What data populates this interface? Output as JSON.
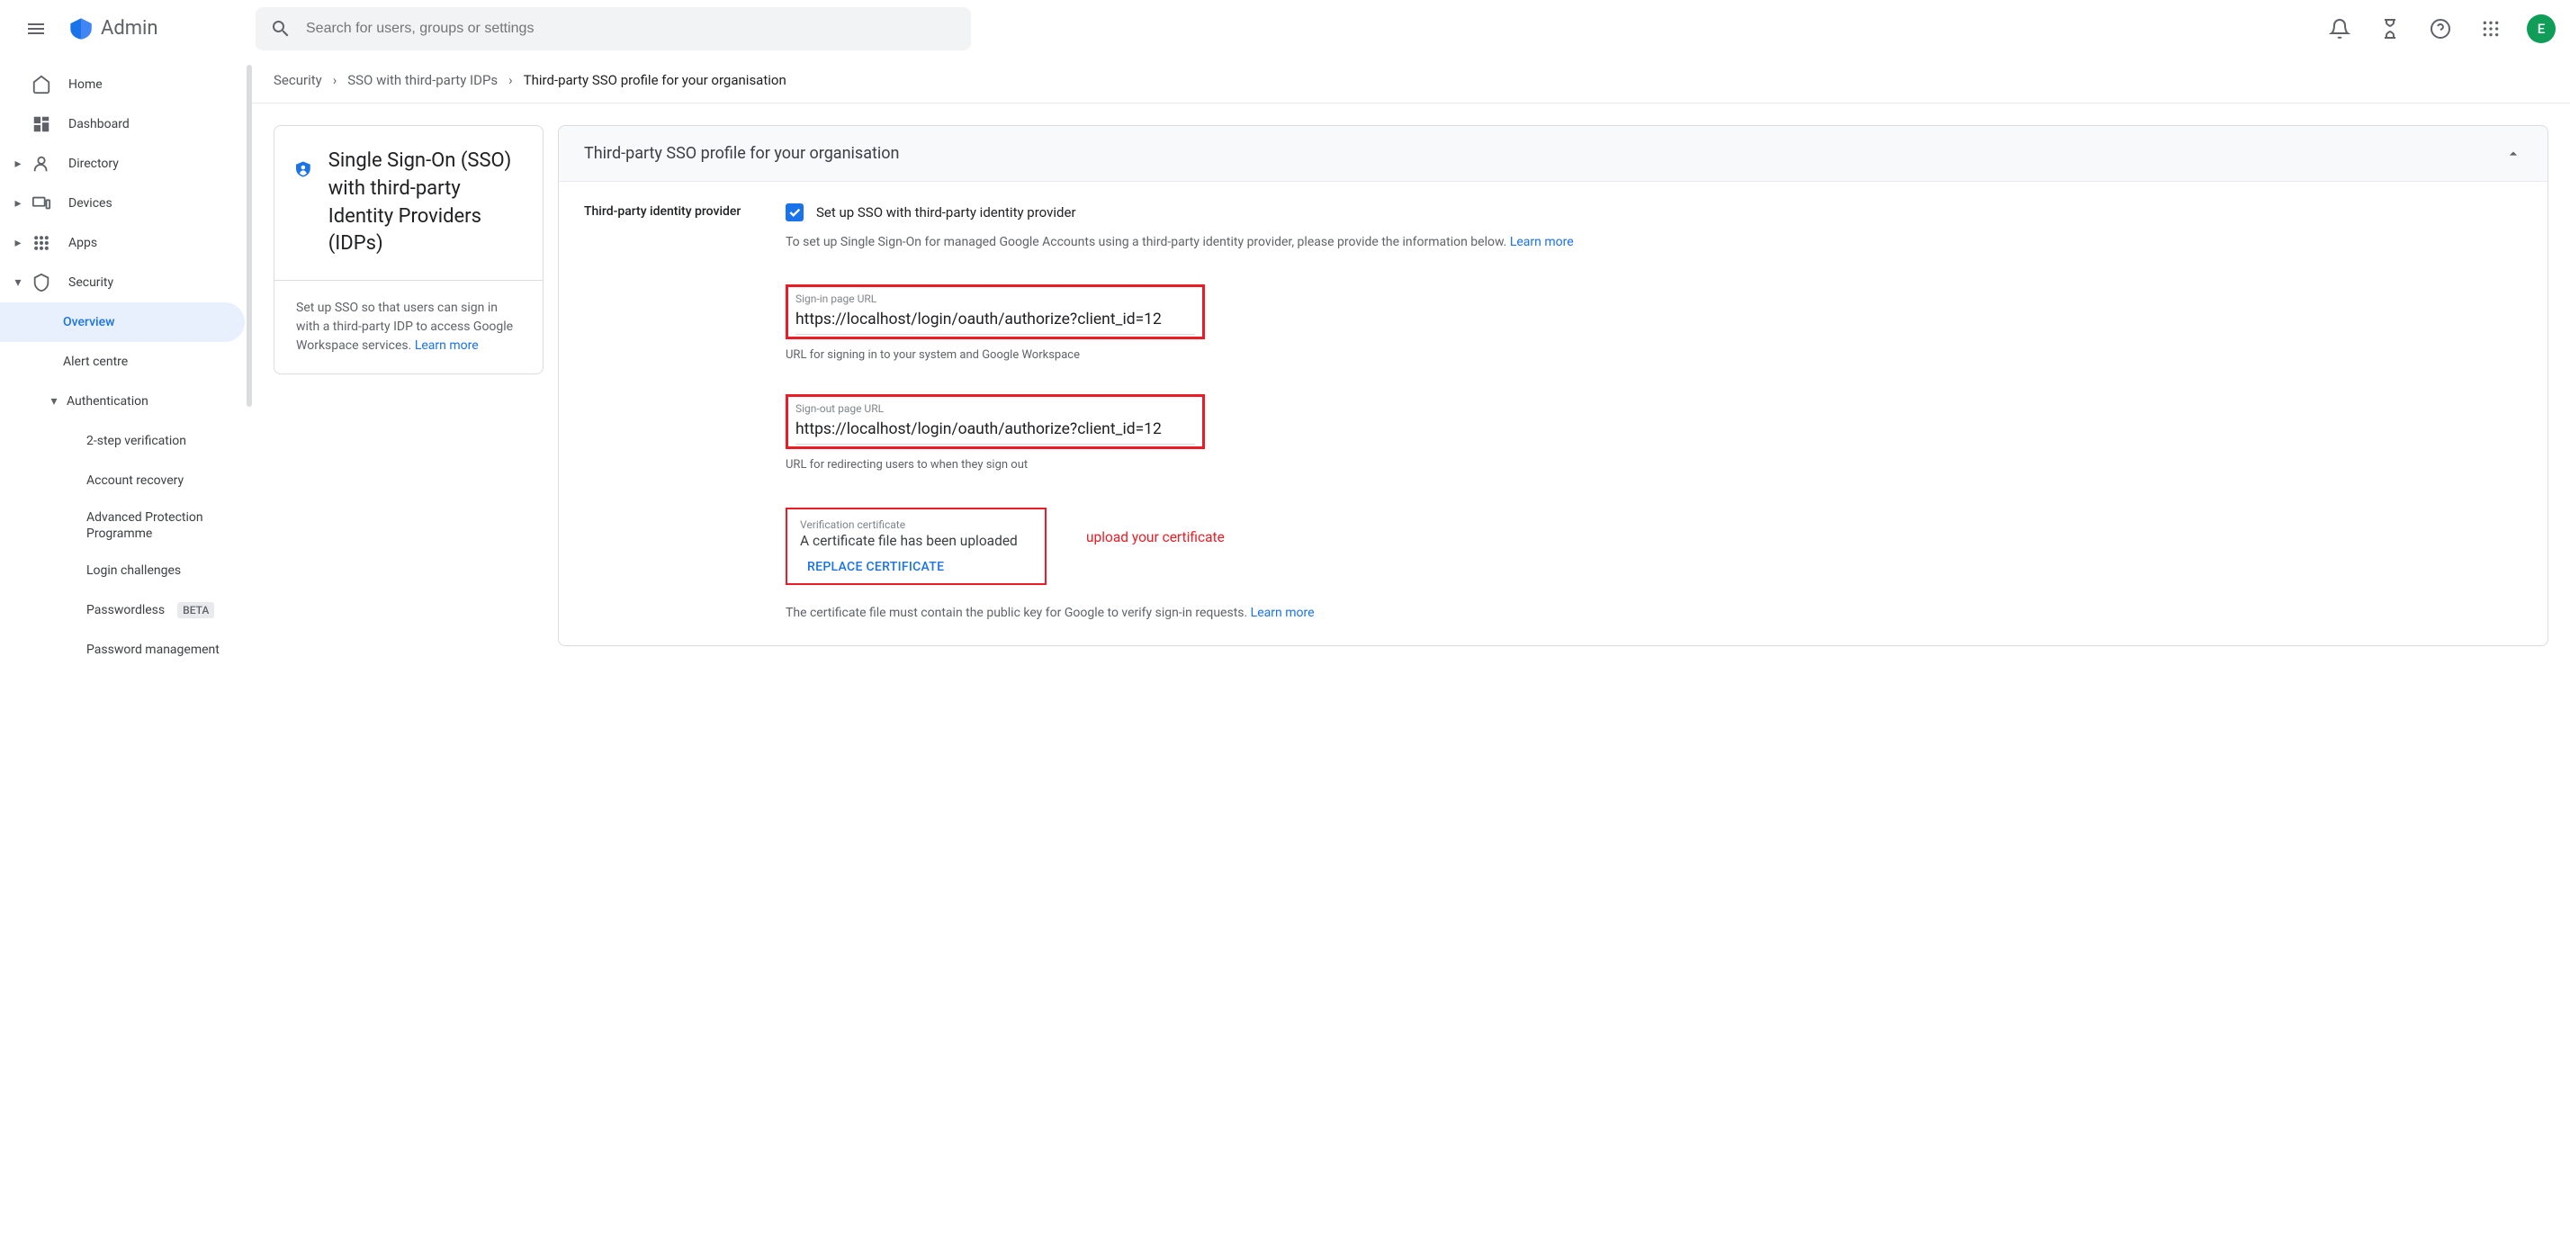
{
  "header": {
    "logo_text": "Admin",
    "search_placeholder": "Search for users, groups or settings",
    "avatar_initial": "E"
  },
  "sidebar": {
    "items": [
      {
        "label": "Home"
      },
      {
        "label": "Dashboard"
      },
      {
        "label": "Directory"
      },
      {
        "label": "Devices"
      },
      {
        "label": "Apps"
      },
      {
        "label": "Security"
      }
    ],
    "security_children": [
      {
        "label": "Overview",
        "active": true
      },
      {
        "label": "Alert centre"
      },
      {
        "label": "Authentication",
        "expanded": true
      }
    ],
    "auth_children": [
      {
        "label": "2-step verification"
      },
      {
        "label": "Account recovery"
      },
      {
        "label": "Advanced Protection Programme"
      },
      {
        "label": "Login challenges"
      },
      {
        "label": "Passwordless",
        "badge": "BETA"
      },
      {
        "label": "Password management"
      }
    ]
  },
  "breadcrumb": {
    "items": [
      "Security",
      "SSO with third-party IDPs",
      "Third-party SSO profile for your organisation"
    ]
  },
  "side_card": {
    "title": "Single Sign-On (SSO) with third-party Identity Providers (IDPs)",
    "desc": "Set up SSO so that users can sign in with a third-party IDP to access Google Workspace services. ",
    "learn_more": "Learn more"
  },
  "panel": {
    "header": "Third-party SSO profile for your organisation",
    "section_label": "Third-party identity provider",
    "checkbox_label": "Set up SSO with third-party identity provider",
    "help_text_1": "To set up Single Sign-On for managed Google Accounts using a third-party identity provider, please provide the information below. ",
    "learn_more": "Learn more",
    "signin": {
      "label": "Sign-in page URL",
      "value": "https://localhost/login/oauth/authorize?client_id=12",
      "hint": "URL for signing in to your system and Google Workspace"
    },
    "signout": {
      "label": "Sign-out page URL",
      "value": "https://localhost/login/oauth/authorize?client_id=12",
      "hint": "URL for redirecting users to when they sign out"
    },
    "cert": {
      "label": "Verification certificate",
      "status": "A certificate file has been uploaded",
      "action": "REPLACE CERTIFICATE",
      "annotation": "upload your certificate",
      "footer": "The certificate file must contain the public key for Google to verify sign-in requests. "
    }
  }
}
